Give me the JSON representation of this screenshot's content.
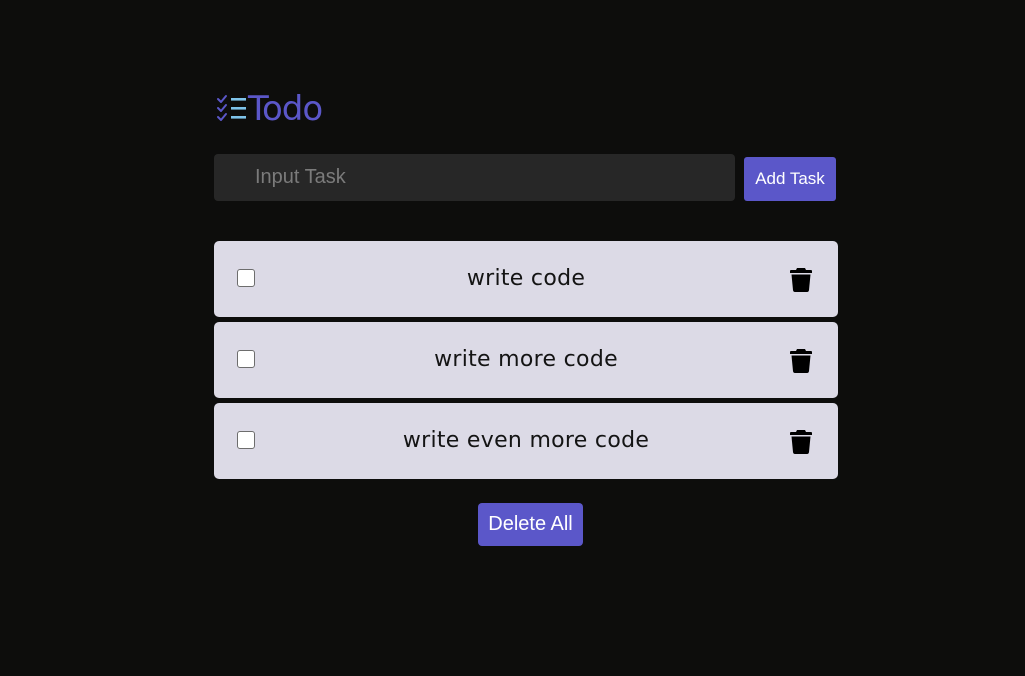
{
  "app": {
    "title": "Todo",
    "logo_icon": "checklist-icon"
  },
  "input": {
    "placeholder": "Input Task",
    "value": ""
  },
  "add_button": {
    "label": "Add Task"
  },
  "tasks": [
    {
      "text": "write code",
      "checked": false
    },
    {
      "text": "write more code",
      "checked": false
    },
    {
      "text": "write even more code",
      "checked": false
    }
  ],
  "delete_all": {
    "label": "Delete All"
  },
  "colors": {
    "background": "#0d0d0c",
    "accent": "#5b57c9",
    "logo_accent_light": "#7ec3ea",
    "input_background": "#272727",
    "task_background": "#dcdae6",
    "task_text": "#141414"
  },
  "icons": {
    "delete_task": "trash-icon"
  }
}
